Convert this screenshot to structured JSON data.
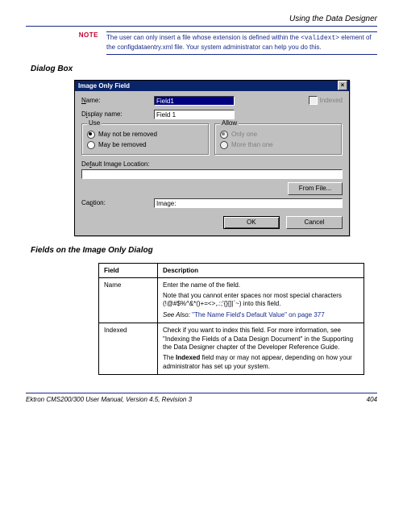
{
  "header": {
    "section": "Using the Data Designer"
  },
  "note": {
    "label": "NOTE",
    "text_before": "The user can only insert a file whose extension is defined within the ",
    "code": "<validext>",
    "text_after": " element of the configdataentry.xml file. Your system administrator can help you do this."
  },
  "sections": {
    "dialog_box": "Dialog Box",
    "fields_on_dialog": "Fields on the Image Only Dialog"
  },
  "dialog": {
    "title": "Image Only Field",
    "close": "×",
    "labels": {
      "name": "Name:",
      "name_ul": "N",
      "display_name": "Display name:",
      "display_ul": "i",
      "indexed": "Indexed",
      "indexed_ul": "x",
      "default_image": "Default Image Location:",
      "default_ul": "f",
      "caption": "Caption:",
      "caption_ul": "p"
    },
    "values": {
      "name": "Field1",
      "display_name": "Field 1",
      "caption": "Image:"
    },
    "groups": {
      "use": {
        "legend": "Use",
        "opt1": "May not be removed",
        "opt1_ul": "o",
        "opt2": "May be removed",
        "opt2_ul": "b",
        "selected": "opt1"
      },
      "allow": {
        "legend": "Allow",
        "opt1": "Only one",
        "opt1_ul": "O",
        "opt2": "More than one",
        "opt2_ul": "M",
        "selected": "opt1"
      }
    },
    "buttons": {
      "from_file": "From File...",
      "from_file_ul": "F",
      "ok": "OK",
      "cancel": "Cancel"
    }
  },
  "table": {
    "headers": {
      "field": "Field",
      "description": "Description"
    },
    "rows": [
      {
        "field": "Name",
        "paras": [
          "Enter the name of the field.",
          "Note that you cannot enter spaces nor most special characters (!@#$%^&*()+=<>,.:;'{}[]|`~) into this field."
        ],
        "see_also_label": "See Also: ",
        "see_also_link": "\"The Name Field's Default Value\" on page 377"
      },
      {
        "field": "Indexed",
        "paras": [
          "Check if you want to index this field. For more information, see \"Indexing the Fields of a Data Design Document\" in the Supporting the Data Designer chapter of the Developer Reference Guide."
        ],
        "extra_prefix": "The ",
        "extra_bold": "Indexed",
        "extra_suffix": " field may or may not appear, depending on how your administrator has set up your system."
      }
    ]
  },
  "footer": {
    "left": "Ektron CMS200/300 User Manual, Version 4.5, Revision 3",
    "right": "404"
  }
}
